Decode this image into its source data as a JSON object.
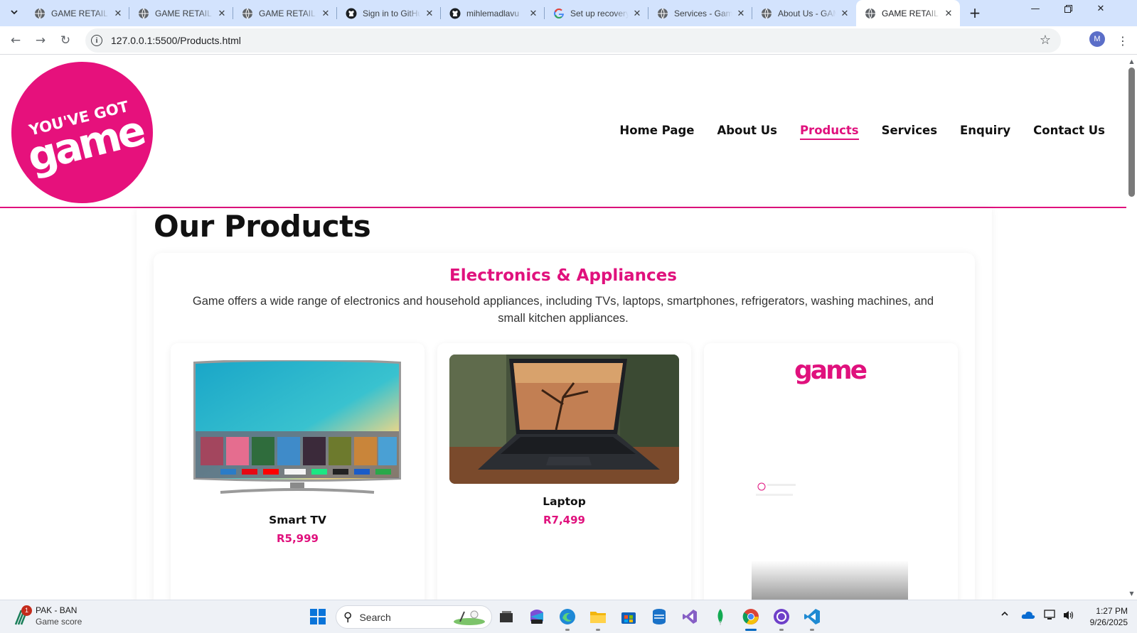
{
  "browser": {
    "tabs": [
      {
        "title": "GAME RETAIL STORE",
        "icon": "globe-icon",
        "active": false
      },
      {
        "title": "GAME RETAIL STORE",
        "icon": "globe-icon",
        "active": false
      },
      {
        "title": "GAME RETAIL STORE",
        "icon": "globe-icon",
        "active": false
      },
      {
        "title": "Sign in to GitHub",
        "icon": "github-icon",
        "active": false
      },
      {
        "title": "mihlemadlavu",
        "icon": "github-icon",
        "active": false
      },
      {
        "title": "Set up recovery",
        "icon": "google-icon",
        "active": false
      },
      {
        "title": "Services - Game",
        "icon": "globe-icon",
        "active": false
      },
      {
        "title": "About Us - GAME",
        "icon": "globe-icon",
        "active": false
      },
      {
        "title": "GAME RETAIL STORE",
        "icon": "globe-icon",
        "active": true
      }
    ],
    "url": "127.0.0.1:5500/Products.html",
    "profile_initial": "M"
  },
  "site": {
    "logo_text_top": "YOU'VE GOT",
    "logo_text_main": "game",
    "nav": [
      {
        "label": "Home Page",
        "active": false
      },
      {
        "label": "About Us",
        "active": false
      },
      {
        "label": "Products",
        "active": true
      },
      {
        "label": "Services",
        "active": false
      },
      {
        "label": "Enquiry",
        "active": false
      },
      {
        "label": "Contact Us",
        "active": false
      }
    ],
    "accent_color": "#e0117d"
  },
  "content": {
    "page_title": "Our Products",
    "category": {
      "title": "Electronics & Appliances",
      "description": "Game offers a wide range of electronics and household appliances, including TVs, laptops, smartphones, refrigerators, washing machines, and small kitchen appliances."
    },
    "products": [
      {
        "name": "Smart TV",
        "price": "R5,999",
        "image": "smart-tv-image"
      },
      {
        "name": "Laptop",
        "price": "R7,499",
        "image": "laptop-image"
      },
      {
        "name": "",
        "price": "",
        "image": "game-phone-video-image",
        "brand": "game"
      }
    ]
  },
  "taskbar": {
    "widget": {
      "title": "PAK - BAN",
      "subtitle": "Game score",
      "badge": "1"
    },
    "search_label": "Search",
    "clock_time": "1:27 PM",
    "clock_date": "9/26/2025"
  }
}
